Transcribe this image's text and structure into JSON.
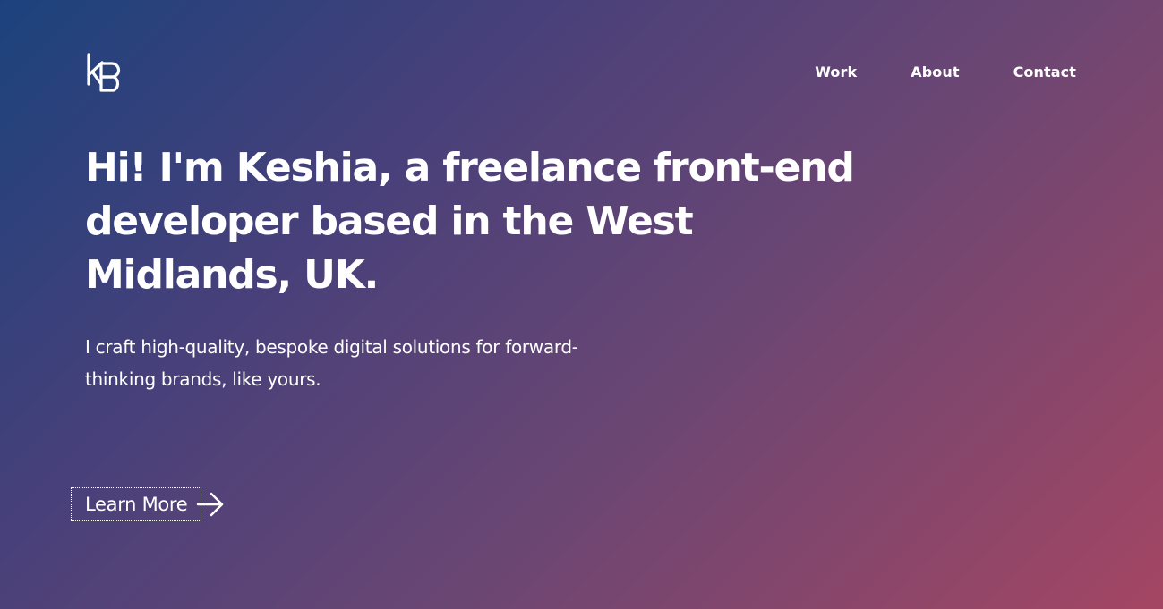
{
  "header": {
    "logo_icon": "kb-monogram-logo",
    "nav": [
      {
        "label": "Work"
      },
      {
        "label": "About"
      },
      {
        "label": "Contact"
      }
    ]
  },
  "hero": {
    "headline": "Hi! I'm Keshia, a freelance front-end developer based in the West Midlands, UK.",
    "subtext": "I craft high-quality, bespoke digital solutions for forward-thinking brands, like yours.",
    "cta_label": "Learn More",
    "cta_icon": "arrow-right-icon"
  },
  "colors": {
    "gradient_start": "#1c427d",
    "gradient_mid": "#6b4673",
    "gradient_end": "#a44663",
    "text": "#ffffff"
  }
}
